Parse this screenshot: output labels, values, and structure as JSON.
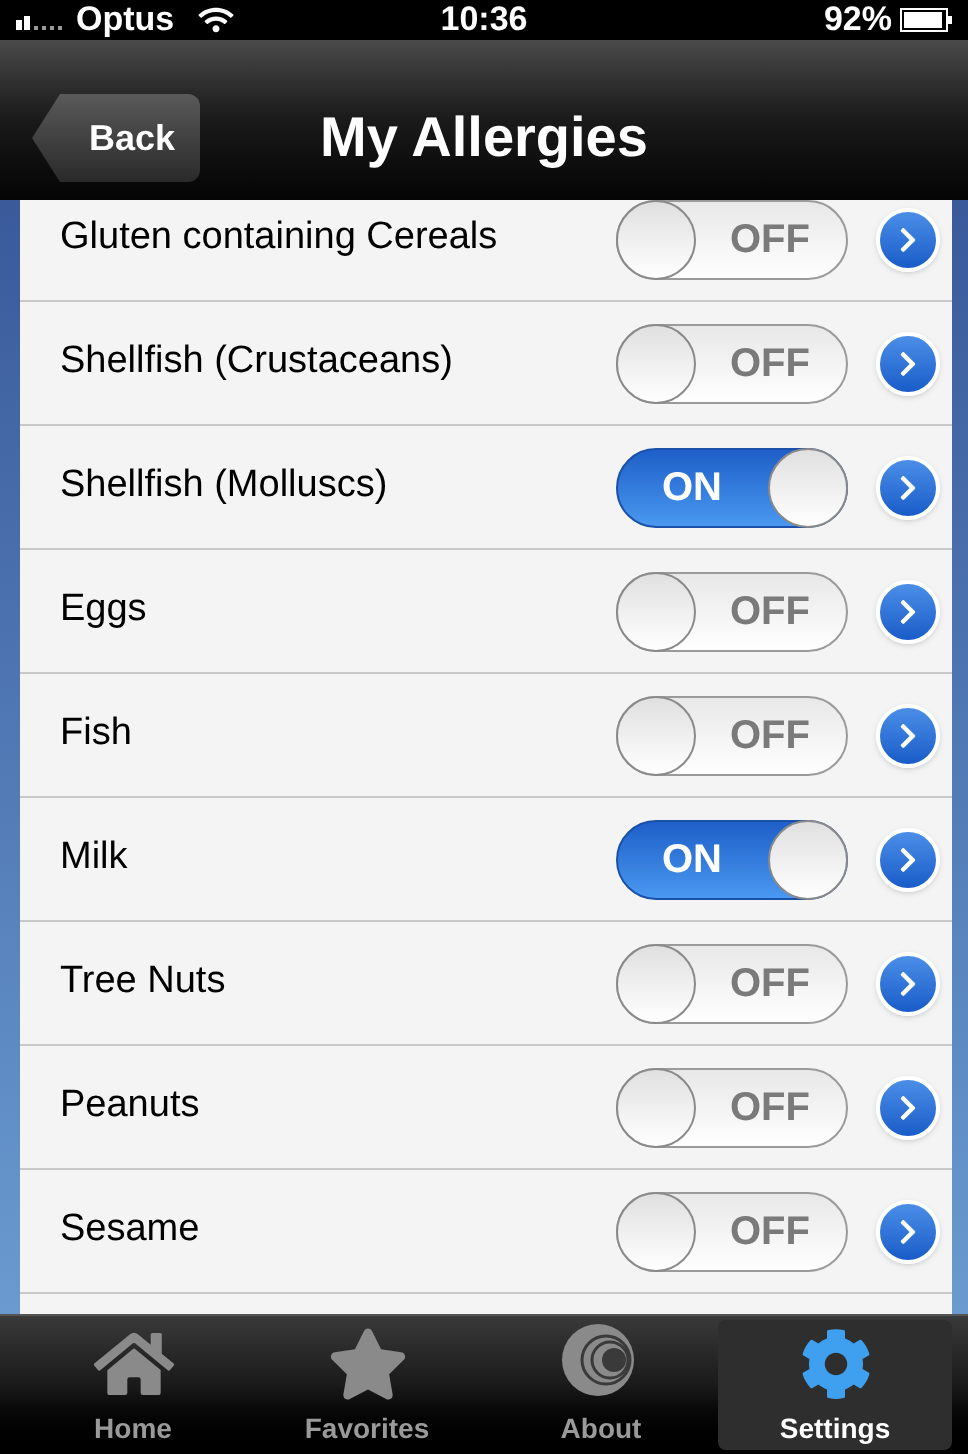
{
  "status_bar": {
    "carrier": "Optus",
    "time": "10:36",
    "battery": "92%"
  },
  "nav_bar": {
    "back": "Back",
    "title": "My Allergies"
  },
  "allergies": [
    {
      "name": "Gluten containing Cereals",
      "on": false,
      "switch_label": "OFF"
    },
    {
      "name": "Shellfish (Crustaceans)",
      "on": false,
      "switch_label": "OFF"
    },
    {
      "name": "Shellfish (Molluscs)",
      "on": true,
      "switch_label": "ON"
    },
    {
      "name": "Eggs",
      "on": false,
      "switch_label": "OFF"
    },
    {
      "name": "Fish",
      "on": false,
      "switch_label": "OFF"
    },
    {
      "name": "Milk",
      "on": true,
      "switch_label": "ON"
    },
    {
      "name": "Tree Nuts",
      "on": false,
      "switch_label": "OFF"
    },
    {
      "name": "Peanuts",
      "on": false,
      "switch_label": "OFF"
    },
    {
      "name": "Sesame",
      "on": false,
      "switch_label": "OFF"
    }
  ],
  "tab_bar": [
    {
      "label": "Home",
      "kind": "home",
      "selected": false
    },
    {
      "label": "Favorites",
      "kind": "star",
      "selected": false
    },
    {
      "label": "About",
      "kind": "logo",
      "selected": false
    },
    {
      "label": "Settings",
      "kind": "gear",
      "selected": true
    }
  ]
}
